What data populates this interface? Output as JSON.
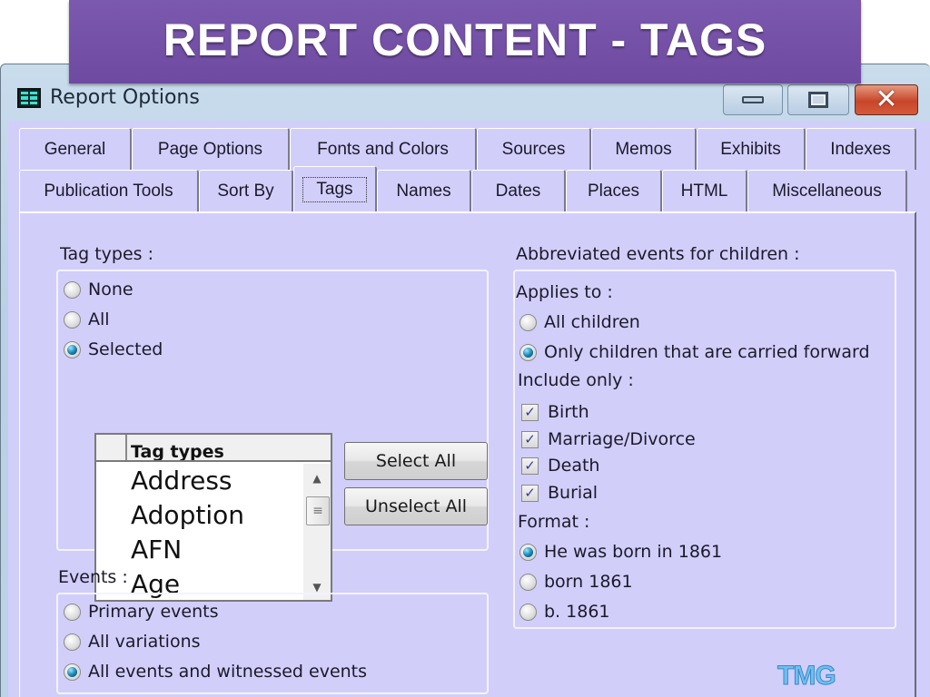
{
  "banner": {
    "title": "REPORT CONTENT - TAGS"
  },
  "window": {
    "title": "Report Options",
    "icon": "report-grid-icon",
    "controls": {
      "minimize": "minimize-icon",
      "maximize": "maximize-icon",
      "close": "close-icon"
    }
  },
  "tabs": {
    "row1": [
      {
        "label": "General"
      },
      {
        "label": "Page Options"
      },
      {
        "label": "Fonts and Colors"
      },
      {
        "label": "Sources"
      },
      {
        "label": "Memos"
      },
      {
        "label": "Exhibits"
      },
      {
        "label": "Indexes"
      }
    ],
    "row2": [
      {
        "label": "Publication Tools"
      },
      {
        "label": "Sort By"
      },
      {
        "label": "Tags",
        "active": true
      },
      {
        "label": "Names"
      },
      {
        "label": "Dates"
      },
      {
        "label": "Places"
      },
      {
        "label": "HTML"
      },
      {
        "label": "Miscellaneous"
      }
    ]
  },
  "tag_types": {
    "label": "Tag types :",
    "options": [
      {
        "label": "None",
        "selected": false
      },
      {
        "label": "All",
        "selected": false
      },
      {
        "label": "Selected",
        "selected": true
      }
    ],
    "list": {
      "column_header": "Tag types",
      "items": [
        "Address",
        "Adoption",
        "AFN",
        "Age"
      ]
    },
    "select_all": "Select All",
    "unselect_all": "Unselect All"
  },
  "events": {
    "label": "Events :",
    "options": [
      {
        "label": "Primary events",
        "selected": false
      },
      {
        "label": "All variations",
        "selected": false
      },
      {
        "label": "All events and witnessed events",
        "selected": true
      }
    ]
  },
  "abbreviated": {
    "label": "Abbreviated events for children :",
    "applies_to": {
      "label": "Applies to :",
      "options": [
        {
          "label": "All children",
          "selected": false
        },
        {
          "label": "Only children that are carried forward",
          "selected": true
        }
      ]
    },
    "include_only": {
      "label": "Include only :",
      "items": [
        {
          "label": "Birth",
          "checked": true
        },
        {
          "label": "Marriage/Divorce",
          "checked": true
        },
        {
          "label": "Death",
          "checked": true
        },
        {
          "label": "Burial",
          "checked": true
        }
      ]
    },
    "format": {
      "label": "Format :",
      "options": [
        {
          "label": "He was born in 1861",
          "selected": true
        },
        {
          "label": "born 1861",
          "selected": false
        },
        {
          "label": "b. 1861",
          "selected": false
        }
      ]
    }
  },
  "logo": {
    "text": "TMG"
  },
  "glyphs": {
    "check": "✓",
    "close": "✕",
    "up": "▲",
    "down": "▼",
    "grip": "≡"
  }
}
